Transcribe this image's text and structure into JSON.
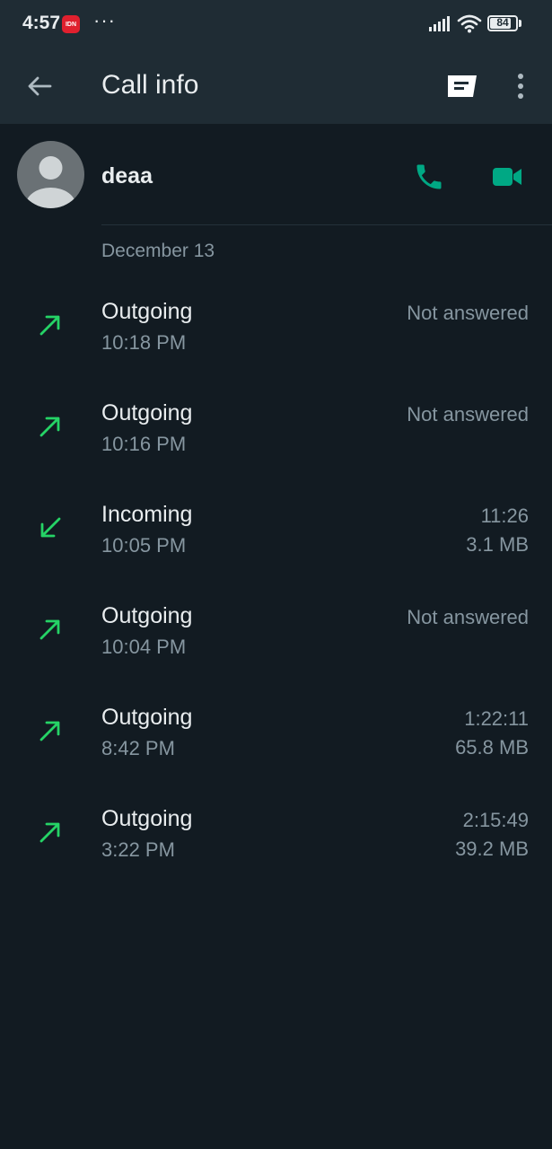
{
  "status_bar": {
    "time": "4:57",
    "badge": "IDN",
    "dots": "···",
    "battery": "84",
    "battery_level": 0.84
  },
  "header": {
    "title": "Call info",
    "back_icon": "arrow-left-icon",
    "message_icon": "message-icon",
    "more_icon": "more-vert-icon"
  },
  "contact": {
    "name": "deaa",
    "avatar_icon": "default-avatar-icon",
    "voice_icon": "phone-icon",
    "video_icon": "video-camera-icon"
  },
  "colors": {
    "accent": "#00a884",
    "arrow": "#25d366",
    "background": "#121b22",
    "header": "#1f2c34",
    "secondary_text": "#8696a0"
  },
  "calls": {
    "date": "December 13",
    "items": [
      {
        "direction": "Outgoing",
        "time": "10:18 PM",
        "status": "Not answered",
        "size": "",
        "icon": "outgoing-arrow-icon"
      },
      {
        "direction": "Outgoing",
        "time": "10:16 PM",
        "status": "Not answered",
        "size": "",
        "icon": "outgoing-arrow-icon"
      },
      {
        "direction": "Incoming",
        "time": "10:05 PM",
        "status": "11:26",
        "size": "3.1 MB",
        "icon": "incoming-arrow-icon"
      },
      {
        "direction": "Outgoing",
        "time": "10:04 PM",
        "status": "Not answered",
        "size": "",
        "icon": "outgoing-arrow-icon"
      },
      {
        "direction": "Outgoing",
        "time": "8:42 PM",
        "status": "1:22:11",
        "size": "65.8 MB",
        "icon": "outgoing-arrow-icon"
      },
      {
        "direction": "Outgoing",
        "time": "3:22 PM",
        "status": "2:15:49",
        "size": "39.2 MB",
        "icon": "outgoing-arrow-icon"
      }
    ]
  }
}
